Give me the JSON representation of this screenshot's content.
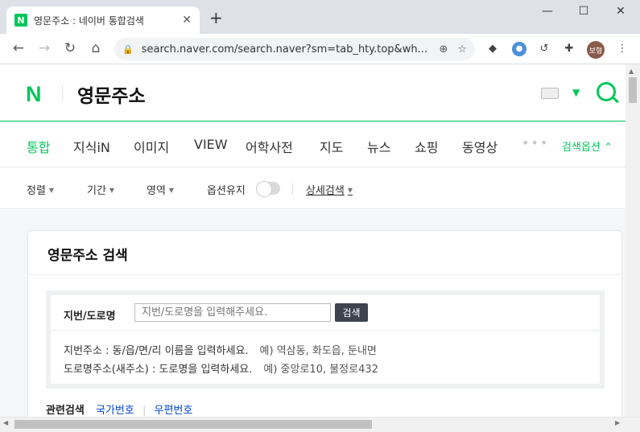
{
  "browser": {
    "tab_title": "영문주소 : 네이버 통합검색",
    "favicon_letter": "N",
    "url": "search.naver.com/search.naver?sm=tab_hty.top&wh...",
    "profile_label": "보형",
    "new_tab_symbol": "+",
    "close_symbol": "✕"
  },
  "header": {
    "logo": "N",
    "query": "영문주소"
  },
  "tabs": [
    {
      "label": "통합",
      "active": true
    },
    {
      "label": "지식iN"
    },
    {
      "label": "이미지"
    },
    {
      "label": "VIEW"
    },
    {
      "label": "어학사전"
    },
    {
      "label": "지도"
    },
    {
      "label": "뉴스"
    },
    {
      "label": "쇼핑"
    },
    {
      "label": "동영상"
    }
  ],
  "tabs_more": "•••",
  "search_options_label": "검색옵션 ⌃",
  "options": {
    "sort": "정렬",
    "period": "기간",
    "area": "영역",
    "keep": "옵션유지",
    "detail": "상세검색"
  },
  "card": {
    "title": "영문주소 검색",
    "input_label": "지번/도로명",
    "input_placeholder": "지번/도로명을 입력해주세요.",
    "button_label": "검색",
    "help": [
      {
        "text": "지번주소 : 동/읍/면/리 이름을 입력하세요.",
        "example": "예) 역삼동, 화도읍, 둔내면"
      },
      {
        "text": "도로명주소(새주소) : 도로명을 입력하세요.",
        "example": "예) 중앙로10, 불정로432"
      }
    ],
    "related_label": "관련검색",
    "related_links": [
      "국가번호",
      "우편번호"
    ]
  },
  "colors": {
    "naver_green": "#03c75a",
    "link_blue": "#0046c8"
  }
}
